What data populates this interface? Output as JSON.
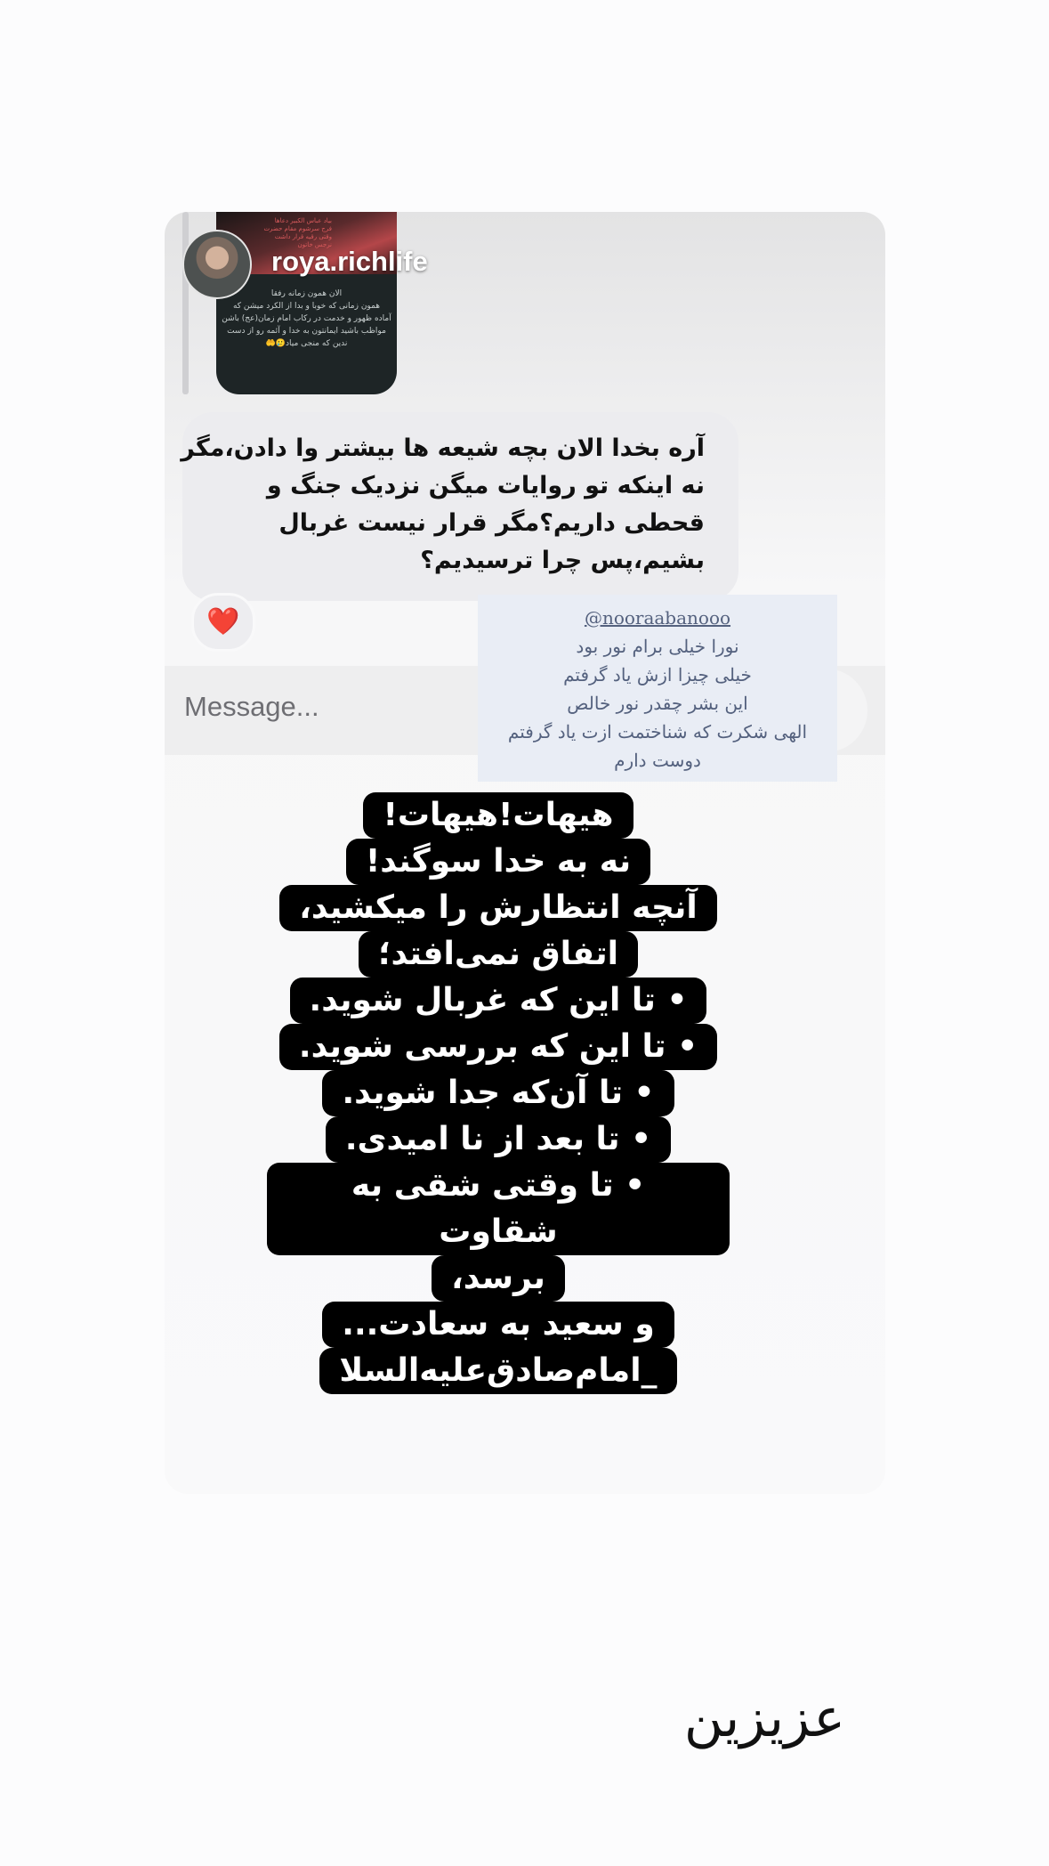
{
  "story_thumbnail": {
    "red_text": "بیاد عباس الکبیر دعاها\nفرج سرشوم مقام حضرت\nوقتی رقیه قرار داشت\nنرجس خاتون",
    "text": "الان همون زمانه رفقا\nهمون زمانی که خوبا و بدا از الکرد میشن که\nآماده ظهور و خدمت در رکاب امام زمان(عج) باشن\nمواظب باشید ایمانتون به خدا و آئمه رو از دست\nندین که منجی میاد🥲🤲"
  },
  "reply": {
    "username": "roya.richlife",
    "message": "آره بخدا الان بچه شیعه ها بیشتر وا دادن،مگر نه اینکه تو روایات میگن نزدیک جنگ و قحطی داریم؟مگر قرار نیست غربال بشیم،پس چرا ترسیدیم؟",
    "reaction": "❤️"
  },
  "composer": {
    "placeholder": "Message..."
  },
  "mention_sticker": {
    "handle": "@nooraabanooo",
    "lines": [
      "نورا خیلی برام نور بود",
      "خیلی چیزا ازش یاد گرفتم",
      "این بشر چقدر نور خالص",
      "الهی شکرت که شناختمت ازت یاد گرفتم",
      "دوست دارم"
    ]
  },
  "quote": {
    "lines": [
      "هیهات!هیهات!",
      "نه به خدا سوگند!",
      "آنچه انتظارش را میکشید،",
      "اتفاق نمی‌افتد؛",
      "• تا این که غربال شوید.",
      "• تا این که بررسی شوید.",
      "• تا آن‌که جدا شوید.",
      "• تا بعد از نا امیدی.",
      "• تا وقتی شقی به شقاوت",
      "برسد،",
      "و سعید به سعادت...",
      "_امام‌صادق‌علیه‌السلا"
    ]
  },
  "caption": "عزیزین"
}
